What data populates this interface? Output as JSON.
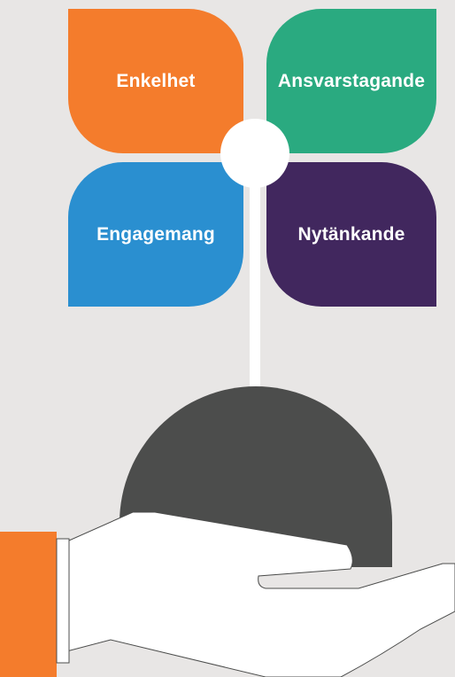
{
  "petals": {
    "top_left": {
      "label": "Enkelhet",
      "color": "#f47c2c"
    },
    "top_right": {
      "label": "Ansvarstagande",
      "color": "#2aaa80"
    },
    "bottom_left": {
      "label": "Engagemang",
      "color": "#2a8fd0"
    },
    "bottom_right": {
      "label": "Nytänkande",
      "color": "#41275e"
    }
  },
  "colors": {
    "background": "#e8e6e5",
    "ball": "#4c4d4c",
    "stem": "#ffffff",
    "hand": "#ffffff",
    "hand_outline": "#4c4d4c",
    "sleeve": "#f47c2c"
  }
}
